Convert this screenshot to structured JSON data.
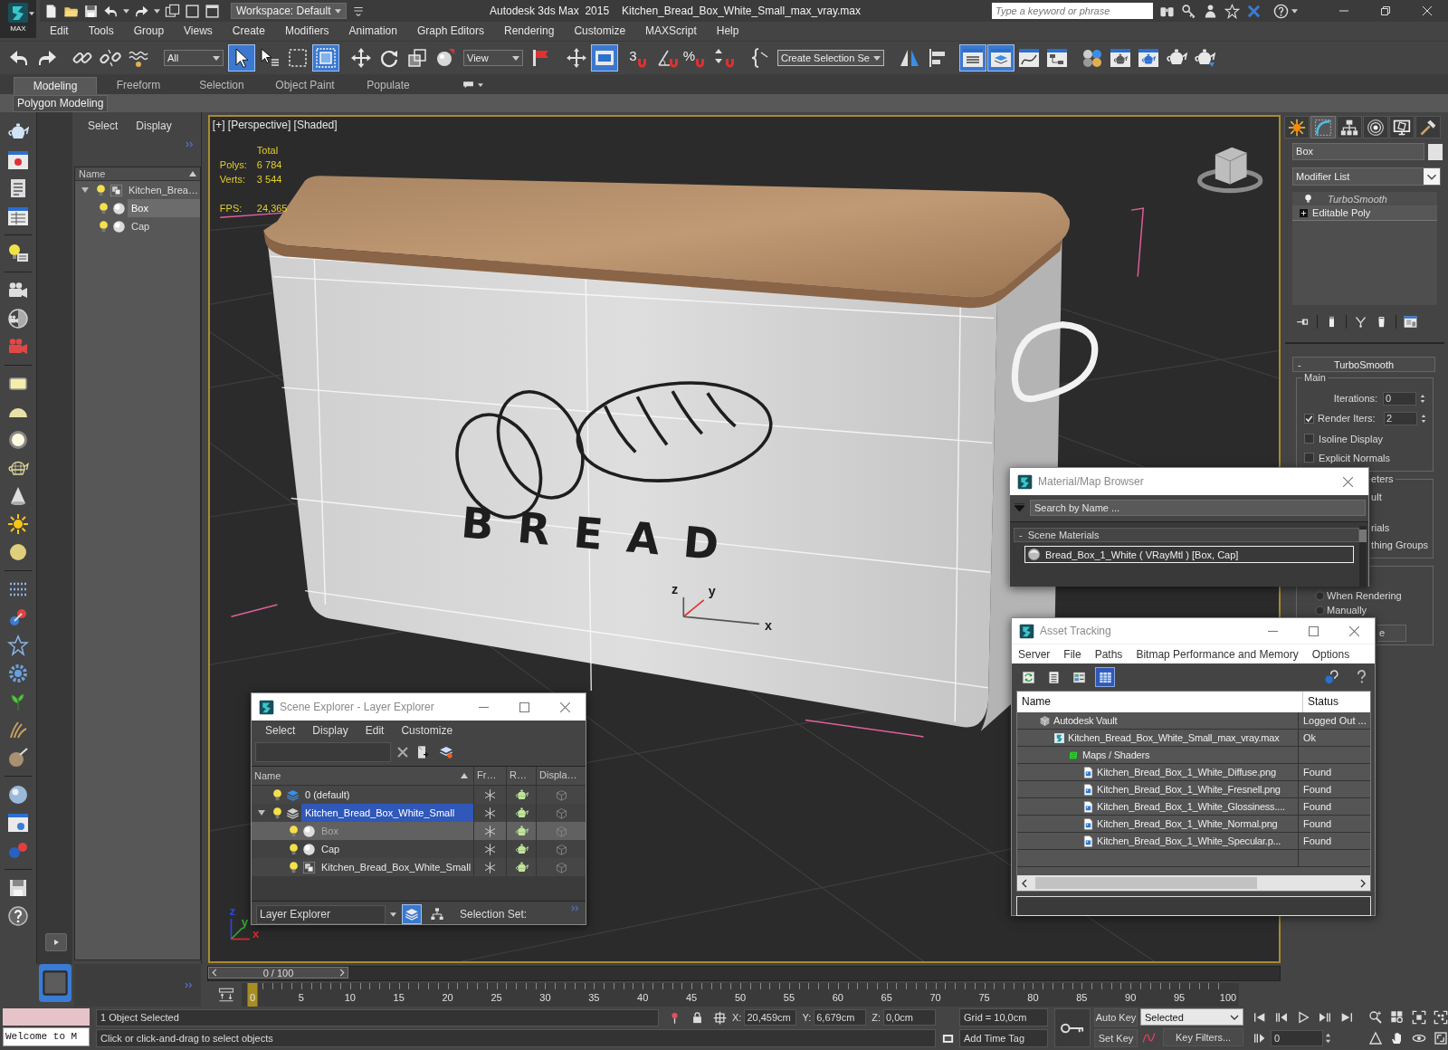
{
  "title_bar": {
    "app_button": "MAX",
    "workspace": "Workspace: Default",
    "app_name": "Autodesk 3ds Max  2015",
    "file_name": "Kitchen_Bread_Box_White_Small_max_vray.max",
    "search": {
      "placeholder": "Type a keyword or phrase"
    }
  },
  "menu_bar": [
    "Edit",
    "Tools",
    "Group",
    "Views",
    "Create",
    "Modifiers",
    "Animation",
    "Graph Editors",
    "Rendering",
    "Customize",
    "MAXScript",
    "Help"
  ],
  "main_toolbar": {
    "groups": [
      [
        {
          "kind": "undo",
          "on": false
        },
        {
          "kind": "redo",
          "on": false
        }
      ],
      [
        {
          "kind": "link",
          "on": false
        },
        {
          "kind": "unlink",
          "on": false
        },
        {
          "kind": "bind",
          "on": false
        }
      ],
      [
        {
          "kind": "dropdown",
          "value": "All",
          "on": false
        },
        {
          "kind": "select",
          "on": true
        },
        {
          "kind": "select_by_name",
          "on": false
        },
        {
          "kind": "region",
          "on": false
        },
        {
          "kind": "crossing",
          "on": true
        }
      ],
      [
        {
          "kind": "move",
          "on": false
        },
        {
          "kind": "rotate",
          "on": false
        },
        {
          "kind": "scale",
          "on": false
        },
        {
          "kind": "place",
          "on": false
        },
        {
          "kind": "dropdown",
          "value": "View",
          "on": false
        },
        {
          "kind": "pivot",
          "on": false
        }
      ],
      [
        {
          "kind": "manipulate",
          "on": false
        },
        {
          "kind": "shortcut",
          "on": true
        }
      ],
      [
        {
          "kind": "snap",
          "label": "3",
          "on": false
        },
        {
          "kind": "angle_snap",
          "on": false
        },
        {
          "kind": "snap",
          "label": "%",
          "on": false
        },
        {
          "kind": "spinner_snap",
          "on": false
        }
      ],
      [
        {
          "kind": "named_sets",
          "on": false
        },
        {
          "kind": "dropdown",
          "value": "Create Selection Se",
          "on": false
        }
      ],
      [
        {
          "kind": "mirror",
          "on": false
        },
        {
          "kind": "align",
          "on": false
        }
      ],
      [
        {
          "kind": "scene_explorer",
          "on": true
        },
        {
          "kind": "layer_explorer",
          "on": true
        },
        {
          "kind": "curve_editor",
          "on": false
        },
        {
          "kind": "schematic",
          "on": false
        }
      ],
      [
        {
          "kind": "material_editor",
          "on": false
        },
        {
          "kind": "render_setup",
          "on": false
        },
        {
          "kind": "frame_window",
          "on": false
        },
        {
          "kind": "render",
          "on": false
        },
        {
          "kind": "render_iterative",
          "on": false
        }
      ]
    ]
  },
  "ribbon": {
    "tabs": [
      {
        "label": "Modeling",
        "selected": true
      },
      {
        "label": "Freeform",
        "selected": false
      },
      {
        "label": "Selection",
        "selected": false
      },
      {
        "label": "Object Paint",
        "selected": false
      },
      {
        "label": "Populate",
        "selected": false
      }
    ],
    "panel_button": "Polygon Modeling"
  },
  "docked_explorer": {
    "menu": [
      "Select",
      "Display"
    ],
    "column": "Name",
    "tree": [
      {
        "name": "Kitchen_Brea…",
        "kind": "group",
        "expanded": true,
        "selected": false,
        "children": [
          {
            "name": "Box",
            "kind": "object",
            "selected": true
          },
          {
            "name": "Cap",
            "kind": "object",
            "selected": false
          }
        ]
      }
    ]
  },
  "viewport": {
    "label": "[+] [Perspective] [Shaded]",
    "stats": {
      "heading": "Total",
      "rows": [
        {
          "label": "Polys:",
          "value": "6 784"
        },
        {
          "label": "Verts:",
          "value": "3 544"
        }
      ],
      "fps": {
        "label": "FPS:",
        "value": "24,365"
      }
    },
    "model_print": "BREAD",
    "gizmo_axes": [
      "z",
      "y",
      "x"
    ],
    "corner_axes": [
      {
        "label": "z",
        "color": "#2848e8"
      },
      {
        "label": "y",
        "color": "#30b030"
      },
      {
        "label": "x",
        "color": "#e02828"
      }
    ]
  },
  "command_panel": {
    "tabs": [
      {
        "kind": "create",
        "selected": false
      },
      {
        "kind": "modify",
        "selected": true
      },
      {
        "kind": "hierarchy",
        "selected": false
      },
      {
        "kind": "motion",
        "selected": false
      },
      {
        "kind": "display",
        "selected": false
      },
      {
        "kind": "utilities",
        "selected": false
      }
    ],
    "object_name": "Box",
    "modifier_list": "Modifier List",
    "stack": [
      {
        "name": "TurboSmooth",
        "kind": "modifier"
      },
      {
        "name": "Editable Poly",
        "kind": "base"
      }
    ],
    "rollout": {
      "toggle": "-",
      "title": "TurboSmooth",
      "group": "Main",
      "iterations": {
        "label": "Iterations:",
        "value": "0"
      },
      "render_iters": {
        "label": "Render Iters:",
        "value": "2",
        "checked": true
      },
      "checkboxes": [
        {
          "label": "Isoline Display",
          "checked": false
        },
        {
          "label": "Explicit Normals",
          "checked": false
        }
      ]
    },
    "covered": {
      "group_title": "eters",
      "lines": [
        "ult",
        "rials",
        "thing Groups"
      ],
      "radios": [
        {
          "label": "When Rendering",
          "selected": false
        },
        {
          "label": "Manually",
          "selected": false
        }
      ],
      "button": "e"
    }
  },
  "scene_explorer": {
    "title": "Scene Explorer - Layer Explorer",
    "menu": [
      "Select",
      "Display",
      "Edit",
      "Customize"
    ],
    "columns": [
      "Name",
      "Fr…",
      "R…",
      "Displa…"
    ],
    "rows": [
      {
        "name": "0 (default)",
        "kind": "layer",
        "current": true,
        "selected": false
      },
      {
        "name": "Kitchen_Bread_Box_White_Small",
        "kind": "layer",
        "current": false,
        "selected": true,
        "expanded": true,
        "children": [
          {
            "name": "Box",
            "kind": "object",
            "selected": true
          },
          {
            "name": "Cap",
            "kind": "object",
            "selected": false
          },
          {
            "name": "Kitchen_Bread_Box_White_Small",
            "kind": "group",
            "selected": false
          }
        ]
      }
    ],
    "mode": "Layer Explorer",
    "views": [
      {
        "kind": "layers",
        "selected": true
      },
      {
        "kind": "hierarchy",
        "selected": false
      }
    ],
    "selection_set": "Selection Set:"
  },
  "material_browser": {
    "title": "Material/Map Browser",
    "search": {
      "placeholder": "Search by Name ..."
    },
    "groups": [
      {
        "toggle": "-",
        "title": "Scene Materials",
        "items": [
          {
            "name": "Bread_Box_1_White ( VRayMtl ) [Box, Cap]",
            "selected": true
          }
        ]
      }
    ]
  },
  "asset_tracking": {
    "title": "Asset Tracking",
    "menu": [
      "Server",
      "File",
      "Paths",
      "Bitmap Performance and Memory",
      "Options"
    ],
    "views": [
      {
        "kind": "refresh",
        "selected": false
      },
      {
        "kind": "list",
        "selected": false
      },
      {
        "kind": "thumbs",
        "selected": false
      },
      {
        "kind": "table",
        "selected": true
      }
    ],
    "columns": [
      "Name",
      "Status"
    ],
    "rows": [
      {
        "name": "Autodesk Vault",
        "kind": "vault",
        "status": "Logged Out ...",
        "children": [
          {
            "name": "Kitchen_Bread_Box_White_Small_max_vray.max",
            "kind": "scene",
            "status": "Ok",
            "children": [
              {
                "name": "Maps / Shaders",
                "kind": "folder",
                "children": [
                  {
                    "name": "Kitchen_Bread_Box_1_White_Diffuse.png",
                    "kind": "bitmap",
                    "status": "Found"
                  },
                  {
                    "name": "Kitchen_Bread_Box_1_White_Fresnell.png",
                    "kind": "bitmap",
                    "status": "Found"
                  },
                  {
                    "name": "Kitchen_Bread_Box_1_White_Glossiness....",
                    "kind": "bitmap",
                    "status": "Found"
                  },
                  {
                    "name": "Kitchen_Bread_Box_1_White_Normal.png",
                    "kind": "bitmap",
                    "status": "Found"
                  },
                  {
                    "name": "Kitchen_Bread_Box_1_White_Specular.p...",
                    "kind": "bitmap",
                    "status": "Found"
                  }
                ]
              }
            ]
          }
        ]
      }
    ]
  },
  "timeline": {
    "slider": {
      "label": "0 / 100",
      "level": 0
    },
    "ticks": [
      "0",
      "5",
      "10",
      "15",
      "20",
      "25",
      "30",
      "35",
      "40",
      "45",
      "50",
      "55",
      "60",
      "65",
      "70",
      "75",
      "80",
      "85",
      "90",
      "95",
      "100"
    ]
  },
  "status_bar": {
    "listener": "Welcome to M",
    "selection": "1 Object Selected",
    "prompt": "Click or click-and-drag to select objects",
    "coords": [
      {
        "label": "X:",
        "value": "20,459cm"
      },
      {
        "label": "Y:",
        "value": "6,679cm"
      },
      {
        "label": "Z:",
        "value": "0,0cm"
      }
    ],
    "grid": "Grid = 10,0cm",
    "time_tag": "Add Time Tag",
    "auto_key": {
      "label": "Auto Key",
      "on": false
    },
    "key_mode": "Selected",
    "set_key": "Set Key",
    "key_filters": "Key Filters...",
    "frame": "0"
  }
}
